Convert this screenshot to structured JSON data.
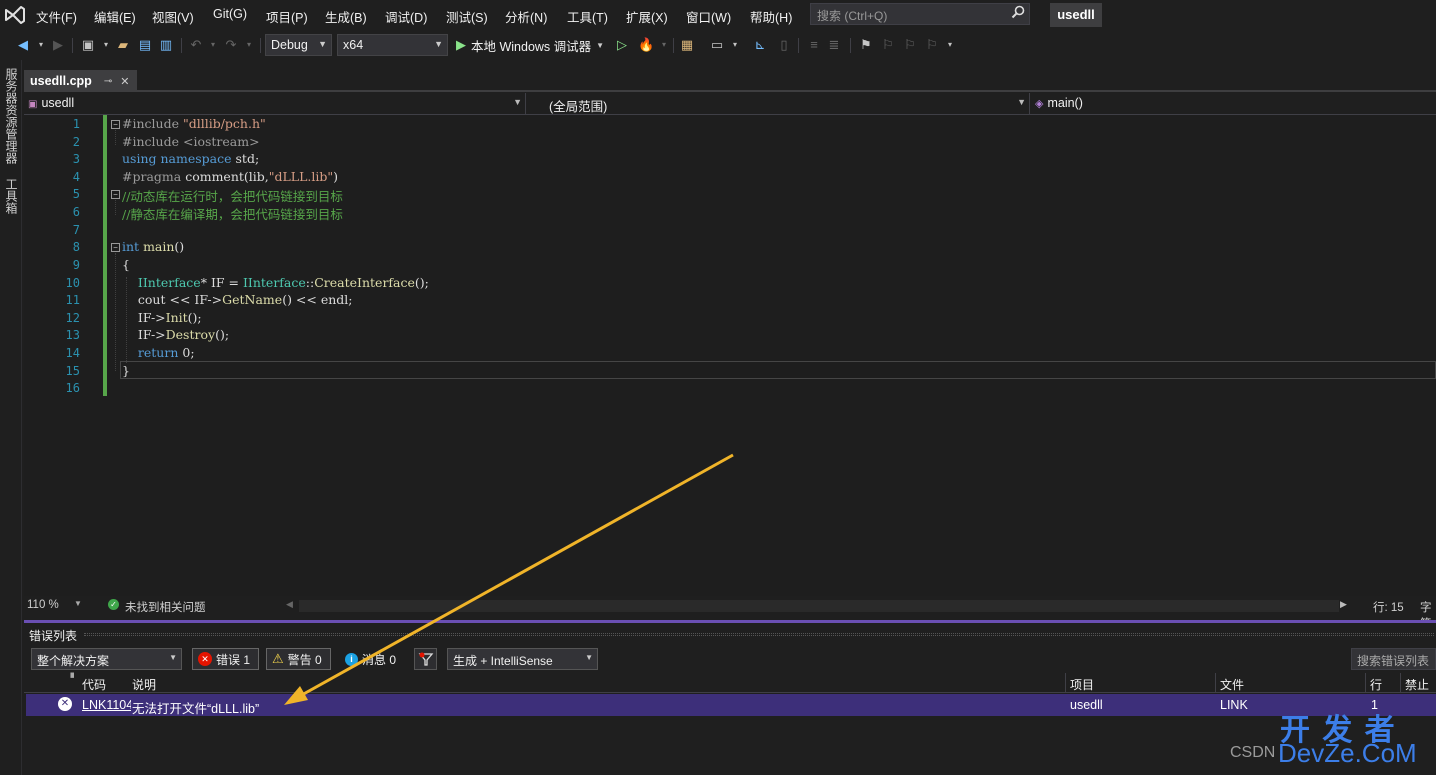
{
  "menubar": {
    "items": [
      "文件(F)",
      "编辑(E)",
      "视图(V)",
      "Git(G)",
      "项目(P)",
      "生成(B)",
      "调试(D)",
      "测试(S)",
      "分析(N)",
      "工具(T)",
      "扩展(X)",
      "窗口(W)",
      "帮助(H)"
    ],
    "search_placeholder": "搜索 (Ctrl+Q)",
    "solution_name": "usedll"
  },
  "toolbar": {
    "configuration": "Debug",
    "platform": "x64",
    "run_label": "本地 Windows 调试器"
  },
  "left_strip": {
    "server_explorer": "服务器资源管理器",
    "toolbox": "工具箱"
  },
  "doc_tab": {
    "filename": "usedll.cpp",
    "pin_glyph": "⊸",
    "close_glyph": "✕"
  },
  "navbar": {
    "project": "usedll",
    "scope": "(全局范围)",
    "member": "main()"
  },
  "code": {
    "lines": [
      "#include \"dlllib/pch.h\"",
      "#include <iostream>",
      "using namespace std;",
      "#pragma comment(lib,\"dLLL.lib\")",
      "//动态库在运行时，会把代码链接到目标",
      "//静态库在编译期，会把代码链接到目标",
      "",
      "int main()",
      "{",
      "    IInterface* IF = IInterface::CreateInterface();",
      "    cout << IF->GetName() << endl;",
      "    IF->Init();",
      "    IF->Destroy();",
      "    return 0;",
      "}",
      ""
    ],
    "line_numbers": [
      "1",
      "2",
      "3",
      "4",
      "5",
      "6",
      "7",
      "8",
      "9",
      "10",
      "11",
      "12",
      "13",
      "14",
      "15",
      "16"
    ]
  },
  "editor_status": {
    "zoom": "110 %",
    "issues": "未找到相关问题",
    "line": "行: 15",
    "char": "字符"
  },
  "error_list": {
    "title": "错误列表",
    "scope": "整个解决方案",
    "errors_label": "错误 1",
    "warnings_label": "警告 0",
    "messages_label": "消息 0",
    "build_filter": "生成 + IntelliSense",
    "search_label": "搜索错误列表",
    "columns": {
      "code": "代码",
      "description": "说明",
      "project": "项目",
      "file": "文件",
      "line": "行",
      "suppression": "禁止显"
    },
    "rows": [
      {
        "code": "LNK1104",
        "description": "无法打开文件“dLLL.lib”",
        "project": "usedll",
        "file": "LINK",
        "line": "1"
      }
    ]
  },
  "watermark": {
    "title": "开 发 者",
    "site": "DevZe.CoM",
    "prefix": "CSDN"
  },
  "colors": {
    "accent": "#6a4fb3",
    "selected_row": "#3d2f7a",
    "error_red": "#e51400",
    "annotation_arrow": "#f0b429"
  }
}
